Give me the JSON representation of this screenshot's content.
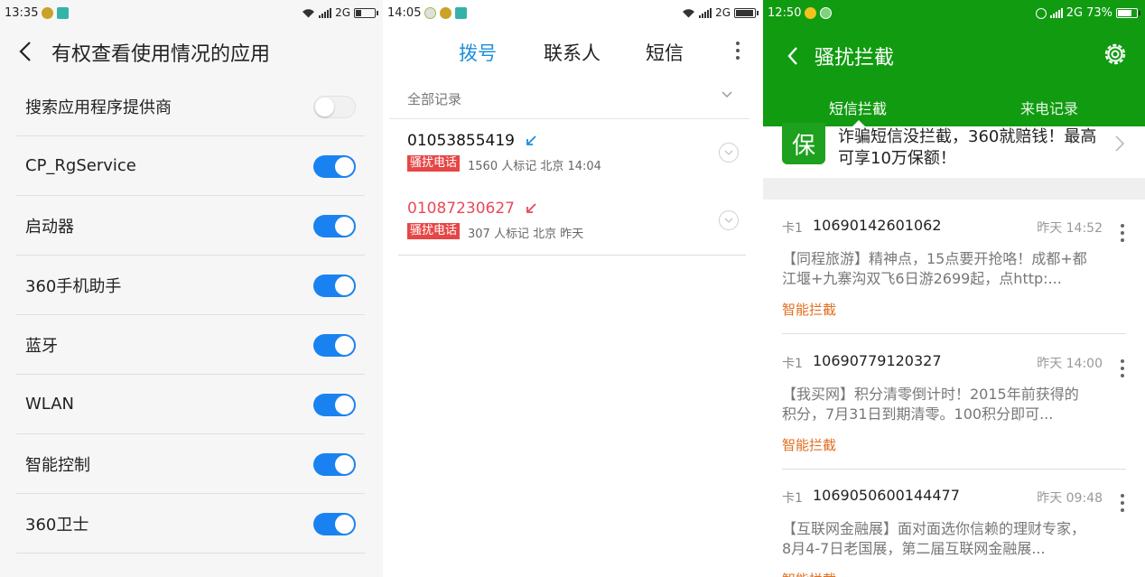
{
  "panel1": {
    "status": {
      "time": "13:35",
      "net": "2G"
    },
    "title": "有权查看使用情况的应用",
    "items": [
      {
        "label": "搜索应用程序提供商",
        "on": false
      },
      {
        "label": "CP_RgService",
        "on": true
      },
      {
        "label": "启动器",
        "on": true
      },
      {
        "label": "360手机助手",
        "on": true
      },
      {
        "label": "蓝牙",
        "on": true
      },
      {
        "label": "WLAN",
        "on": true
      },
      {
        "label": "智能控制",
        "on": true
      },
      {
        "label": " 360卫士",
        "on": true
      }
    ]
  },
  "panel2": {
    "status": {
      "time": "14:05",
      "net": "2G"
    },
    "tabs": [
      {
        "label": "拨号",
        "active": true
      },
      {
        "label": "联系人",
        "active": false
      },
      {
        "label": "短信",
        "active": false
      }
    ],
    "filter_label": "全部记录",
    "calls": [
      {
        "number": "01053855419",
        "badge": "骚扰电话",
        "meta": "1560 人标记 北京 14:04",
        "color": "#1d8fdb"
      },
      {
        "number": "01087230627",
        "badge": "骚扰电话",
        "meta": "307 人标记 北京 昨天",
        "color": "#e84a5a"
      }
    ]
  },
  "panel3": {
    "status": {
      "time": "12:50",
      "net": "2G",
      "battery": "73%"
    },
    "title": "骚扰拦截",
    "tabs": [
      {
        "label": "短信拦截",
        "active": true
      },
      {
        "label": "来电记录",
        "active": false
      }
    ],
    "promo": {
      "badge": "保",
      "text": "诈骗短信没拦截，360就赔钱！最高可享10万保额！"
    },
    "messages": [
      {
        "card": "卡1",
        "sender": "10690142601062",
        "date": "昨天 14:52",
        "body": "【同程旅游】精神点，15点要开抢咯！成都+都江堰+九寨沟双飞6日游2699起，点http:...",
        "tag": "智能拦截"
      },
      {
        "card": "卡1",
        "sender": "10690779120327",
        "date": "昨天 14:00",
        "body": "【我买网】积分清零倒计时！2015年前获得的积分，7月31日到期清零。100积分即可...",
        "tag": "智能拦截"
      },
      {
        "card": "卡1",
        "sender": "1069050600144477",
        "date": "昨天 09:48",
        "body": "【互联网金融展】面对面选你信赖的理财专家，8月4-7日老国展，第二届互联网金融展...",
        "tag": "智能拦截"
      }
    ],
    "colors": {
      "header": "#119b11",
      "tag": "#e06e1e"
    }
  }
}
